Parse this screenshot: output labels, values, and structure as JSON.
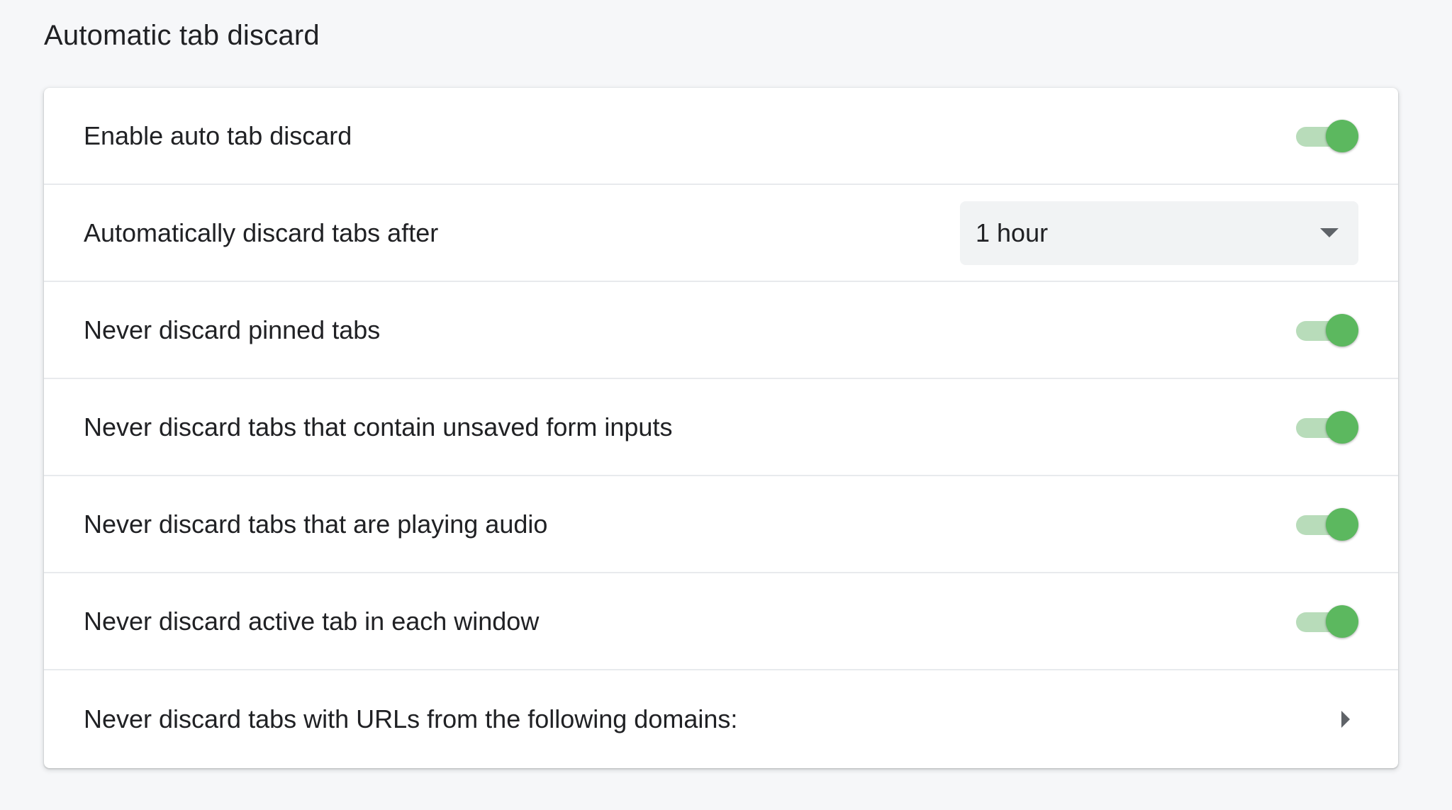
{
  "section": {
    "title": "Automatic tab discard"
  },
  "settings": {
    "enable_auto_discard": {
      "label": "Enable auto tab discard",
      "enabled": true
    },
    "discard_after": {
      "label": "Automatically discard tabs after",
      "selected": "1 hour",
      "icon": "dropdown-caret-icon"
    },
    "never_pinned": {
      "label": "Never discard pinned tabs",
      "enabled": true
    },
    "never_form_inputs": {
      "label": "Never discard tabs that contain unsaved form inputs",
      "enabled": true
    },
    "never_audio": {
      "label": "Never discard tabs that are playing audio",
      "enabled": true
    },
    "never_active": {
      "label": "Never discard active tab in each window",
      "enabled": true
    },
    "never_domains": {
      "label": "Never discard tabs with URLs from the following domains:",
      "icon": "chevron-right-icon"
    }
  },
  "colors": {
    "toggle_on_knob": "#5cb85f",
    "toggle_on_track": "#b8dcba",
    "page_background": "#f6f7f9",
    "card_background": "#ffffff"
  }
}
